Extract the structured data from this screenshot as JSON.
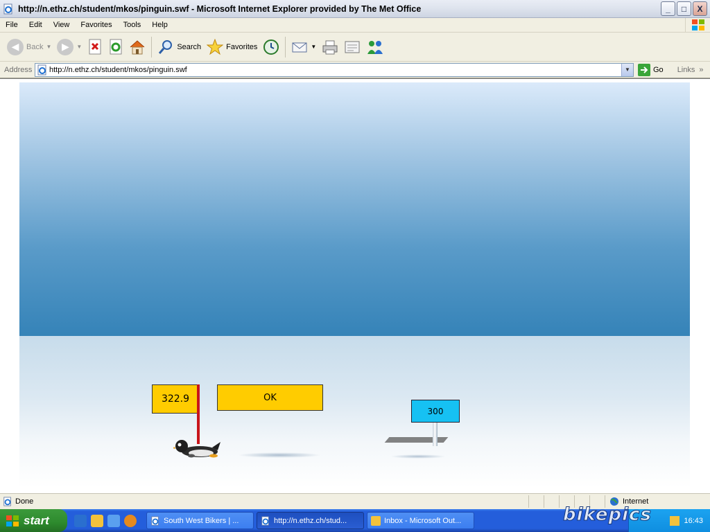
{
  "window": {
    "title": "http://n.ethz.ch/student/mkos/pinguin.swf - Microsoft Internet Explorer provided by The Met Office",
    "buttons": [
      "_",
      "□",
      "X"
    ]
  },
  "menu": [
    "File",
    "Edit",
    "View",
    "Favorites",
    "Tools",
    "Help"
  ],
  "toolbar": {
    "back_label": "Back",
    "search_label": "Search",
    "favorites_label": "Favorites"
  },
  "address": {
    "label": "Address",
    "url": "http://n.ethz.ch/student/mkos/pinguin.swf",
    "go_label": "Go",
    "links_label": "Links",
    "chevron": "»"
  },
  "game": {
    "distance": "322.9",
    "ok_label": "OK",
    "marker_label": "300"
  },
  "status": {
    "text": "Done",
    "zone": "Internet"
  },
  "taskbar": {
    "start_label": "start",
    "tasks": [
      "South West Bikers | ...",
      "http://n.ethz.ch/stud...",
      "Inbox - Microsoft Out..."
    ],
    "clock": "16:43"
  },
  "watermark": "bikepics",
  "colors": {
    "sign_yellow": "#ffcc00",
    "marker_blue": "#16c1f3",
    "pole_red": "#c8151b",
    "sky_top": "#dbeafa",
    "sky_bottom": "#3583b8"
  }
}
